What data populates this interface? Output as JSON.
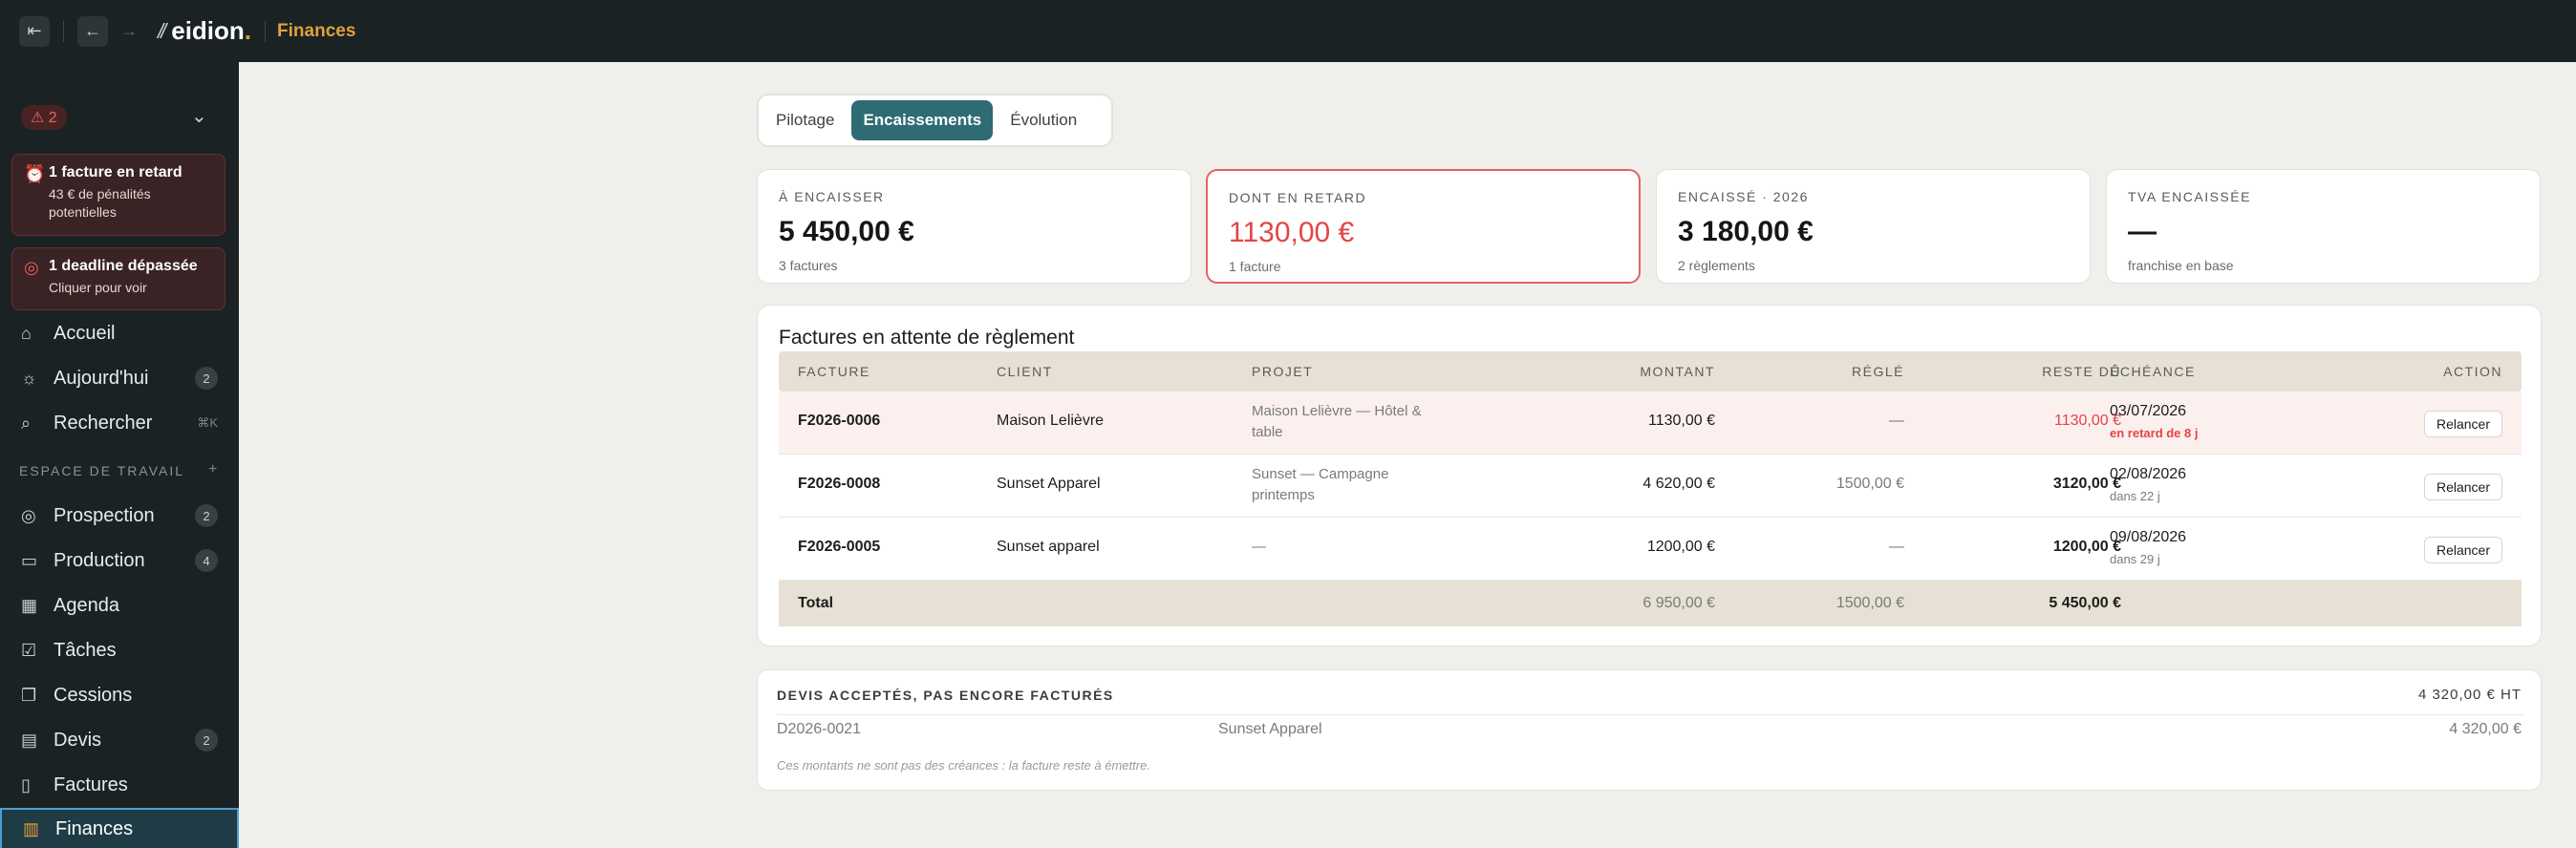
{
  "topbar": {
    "brand": "eidion",
    "brand_dot": ".",
    "breadcrumb": "Finances"
  },
  "sidebar": {
    "alert_count": "⚠ 2",
    "alerts": [
      {
        "title": "1 facture en retard",
        "detail": "43 € de pénalités potentielles",
        "icon": "alarm-clock-icon"
      },
      {
        "title": "1 deadline dépassée",
        "detail": "Cliquer pour voir",
        "icon": "target-icon"
      }
    ],
    "nav_top": [
      {
        "label": "Accueil",
        "icon": "home-icon"
      },
      {
        "label": "Aujourd'hui",
        "icon": "sun-icon",
        "badge": "2"
      },
      {
        "label": "Rechercher",
        "icon": "search-icon",
        "shortcut": "⌘K"
      }
    ],
    "section_label": "ESPACE DE TRAVAIL",
    "section_plus": "+",
    "nav_workspace": [
      {
        "label": "Prospection",
        "icon": "target-icon",
        "badge": "2"
      },
      {
        "label": "Production",
        "icon": "folder-icon",
        "badge": "4"
      },
      {
        "label": "Agenda",
        "icon": "calendar-icon"
      },
      {
        "label": "Tâches",
        "icon": "checkbox-icon"
      },
      {
        "label": "Cessions",
        "icon": "document-stack-icon"
      },
      {
        "label": "Devis",
        "icon": "quote-document-icon",
        "badge": "2"
      },
      {
        "label": "Factures",
        "icon": "invoice-icon"
      },
      {
        "label": "Finances",
        "icon": "bar-chart-icon",
        "active": true
      }
    ]
  },
  "tabs": [
    {
      "label": "Pilotage",
      "active": false
    },
    {
      "label": "Encaissements",
      "active": true
    },
    {
      "label": "Évolution",
      "active": false
    }
  ],
  "kpis": [
    {
      "label": "À ENCAISSER",
      "value": "5 450,00 €",
      "sub": "3 factures"
    },
    {
      "label": "DONT EN RETARD",
      "value": "1130,00 €",
      "sub": "1 facture",
      "alert": true
    },
    {
      "label": "ENCAISSÉ · 2026",
      "value": "3 180,00 €",
      "sub": "2 règlements"
    },
    {
      "label": "TVA ENCAISSÉE",
      "value": "—",
      "sub": "franchise en base"
    }
  ],
  "invoices": {
    "title": "Factures en attente de règlement",
    "columns": [
      "FACTURE",
      "CLIENT",
      "PROJET",
      "MONTANT",
      "RÉGLÉ",
      "RESTE DÛ",
      "ÉCHÉANCE",
      "ACTION"
    ],
    "rows": [
      {
        "facture": "F2026-0006",
        "client": "Maison Lelièvre",
        "projet_l1": "Maison Lelièvre — Hôtel &",
        "projet_l2": "table",
        "montant": "1130,00 €",
        "regle": "—",
        "reste": "1130,00 €",
        "echeance": "03/07/2026",
        "echeance_sub": "en retard de 8 j",
        "late": true,
        "action": "Relancer"
      },
      {
        "facture": "F2026-0008",
        "client": "Sunset Apparel",
        "projet_l1": "Sunset — Campagne",
        "projet_l2": "printemps",
        "montant": "4 620,00 €",
        "regle": "1500,00 €",
        "reste": "3120,00 €",
        "echeance": "02/08/2026",
        "echeance_sub": "dans 22 j",
        "late": false,
        "action": "Relancer"
      },
      {
        "facture": "F2026-0005",
        "client": "Sunset apparel",
        "projet_l1": "—",
        "projet_l2": "",
        "montant": "1200,00 €",
        "regle": "—",
        "reste": "1200,00 €",
        "echeance": "09/08/2026",
        "echeance_sub": "dans 29 j",
        "late": false,
        "action": "Relancer"
      }
    ],
    "total": {
      "label": "Total",
      "montant": "6 950,00 €",
      "regle": "1500,00 €",
      "reste": "5 450,00 €"
    }
  },
  "devis": {
    "header": "DEVIS ACCEPTÉS, PAS ENCORE FACTURÉS",
    "header_value": "4 320,00 € HT",
    "rows": [
      {
        "id": "D2026-0021",
        "client": "Sunset Apparel",
        "amount": "4 320,00 €"
      }
    ],
    "note": "Ces montants ne sont pas des créances : la facture reste à émettre."
  },
  "colors": {
    "topbar_bg": "#1a2224",
    "accent_teal": "#2f6b72",
    "brand_accent": "#e0a13b",
    "alert_red": "#e24545",
    "page_bg": "#f0efeb"
  }
}
